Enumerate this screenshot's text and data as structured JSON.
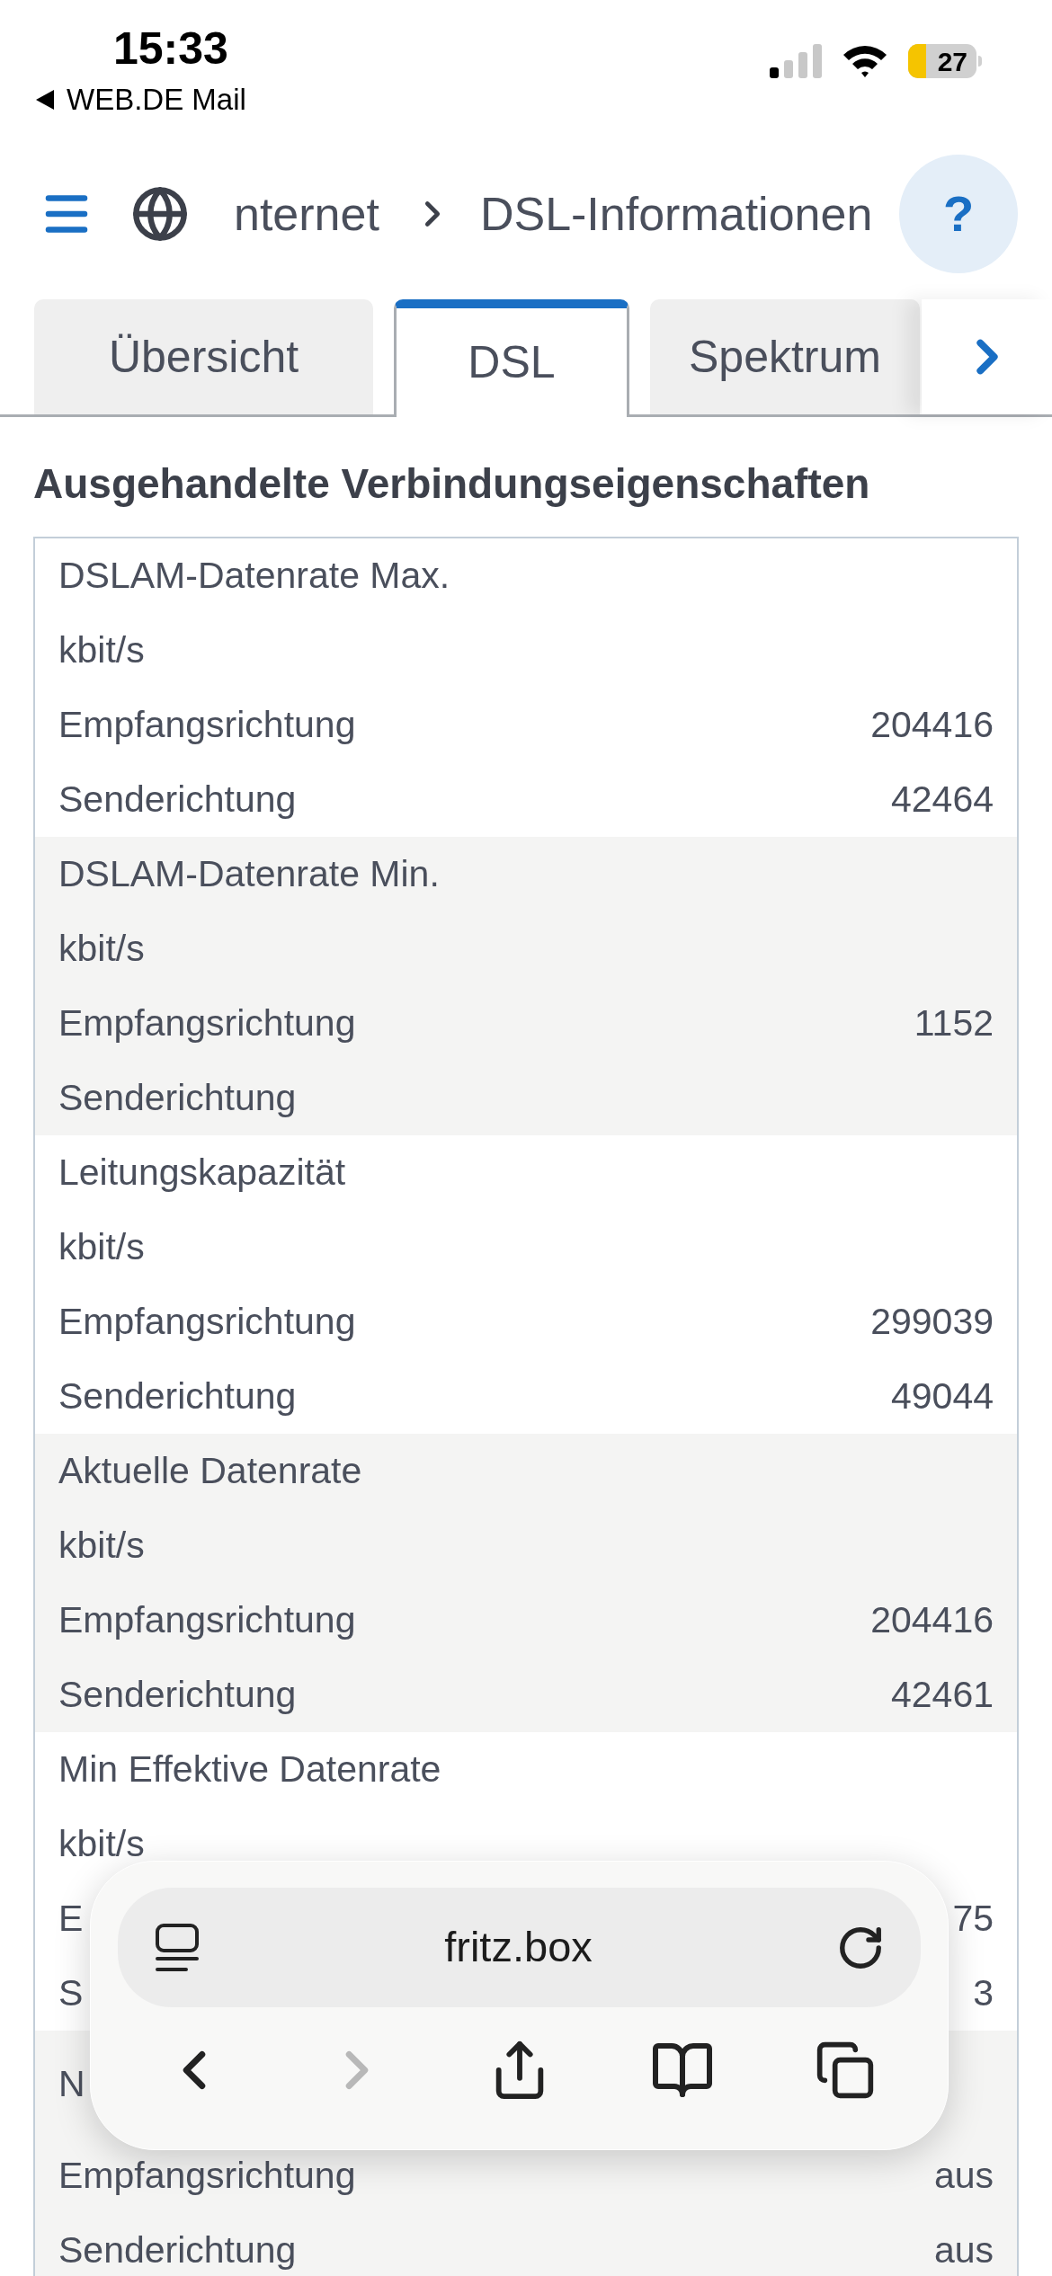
{
  "status_bar": {
    "time": "15:33",
    "back_app": "WEB.DE Mail",
    "battery": "27"
  },
  "breadcrumb": [
    "nternet",
    "DSL-Informationen"
  ],
  "help_button": "?",
  "tabs": [
    {
      "label": "Übersicht",
      "selected": false
    },
    {
      "label": "DSL",
      "selected": true
    },
    {
      "label": "Spektrum",
      "selected": false
    }
  ],
  "section_title": "Ausgehandelte Verbindungseigenschaften",
  "groups": [
    {
      "title": "DSLAM-Datenrate Max.",
      "unit": "kbit/s",
      "rows": [
        {
          "label": "Empfangsrichtung",
          "value": "204416"
        },
        {
          "label": "Senderichtung",
          "value": "42464"
        }
      ]
    },
    {
      "title": "DSLAM-Datenrate Min.",
      "unit": "kbit/s",
      "rows": [
        {
          "label": "Empfangsrichtung",
          "value": "1152"
        },
        {
          "label": "Senderichtung"
        }
      ]
    },
    {
      "title": "Leitungskapazität",
      "unit": "kbit/s",
      "rows": [
        {
          "label": "Empfangsrichtung",
          "value": "299039"
        },
        {
          "label": "Senderichtung",
          "value": "49044"
        }
      ]
    },
    {
      "title": "Aktuelle Datenrate",
      "unit": "kbit/s",
      "rows": [
        {
          "label": "Empfangsrichtung",
          "value": "204416"
        },
        {
          "label": "Senderichtung",
          "value": "42461"
        }
      ]
    },
    {
      "title": "Min Effektive Datenrate",
      "unit": "kbit/s",
      "rows": [
        {
          "label": "E",
          "value": "75"
        },
        {
          "label": "S",
          "value": "3"
        }
      ]
    },
    {
      "title": "N",
      "rows": [
        {
          "label": "Empfangsrichtung",
          "value": "aus"
        },
        {
          "label": "Senderichtung",
          "value": "aus"
        }
      ]
    }
  ],
  "browser_bar": {
    "url": "fritz.box"
  }
}
